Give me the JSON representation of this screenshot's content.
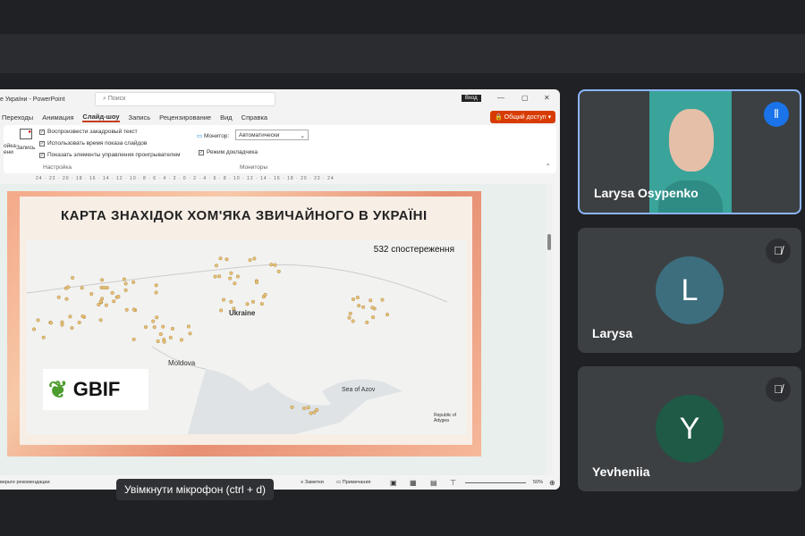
{
  "window": {
    "title": "е України - PowerPoint",
    "search_placeholder": "Поиск",
    "signin": "Вход"
  },
  "ribbon": {
    "tabs": [
      "Переходы",
      "Анимация",
      "Слайд-шоу",
      "Запись",
      "Рецензирование",
      "Вид",
      "Справка"
    ],
    "active_tab": "Слайд-шоу",
    "share": "Общий доступ",
    "checkboxes": [
      "Воспроизвести закадровый текст",
      "Использовать время показа слайдов",
      "Показать элементы управления проигрывателем"
    ],
    "record_label": "Запись",
    "setup_label": "ойка\nени",
    "group_setup": "Настройка",
    "monitor_label": "Монитор:",
    "monitor_value": "Автоматически",
    "presenter_view": "Режим докладчика",
    "group_monitors": "Мониторы"
  },
  "ruler": "24 · 22 · 20 · 18 · 16 · 14 · 12 · 10 · 8 · 6 · 4 · 2 · 0 · 2 · 4 · 6 · 8 · 10 · 12 · 14 · 16 · 18 · 20 · 22 · 24",
  "slide": {
    "title": "КАРТА ЗНАХІДОК ХОМ'ЯКА ЗВИЧАЙНОГО В УКРАЇНІ",
    "count": "532 спостереження",
    "labels": {
      "ukraine": "Ukraine",
      "moldova": "Moldova",
      "azov": "Sea of Azov",
      "adygea": "Republic of Adygea"
    },
    "logo": "GBIF"
  },
  "status": {
    "left": "верьте рекомендации",
    "notes": "Заметки",
    "comments": "Примечания",
    "zoom": "50%"
  },
  "tooltip": "Увімкнути мікрофон (ctrl + d)",
  "participants": [
    {
      "name": "Larysa Osypenko",
      "speaking": true
    },
    {
      "name": "Larysa",
      "initial": "L",
      "color": "#3c6e7e"
    },
    {
      "name": "Yevheniia",
      "initial": "Y",
      "color": "#1e5a46"
    }
  ]
}
